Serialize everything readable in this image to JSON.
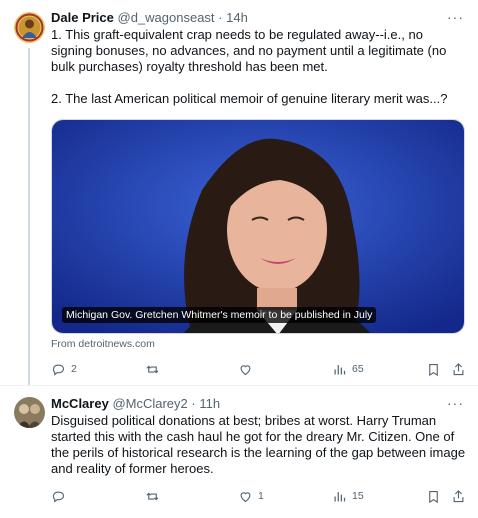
{
  "tweets": [
    {
      "name": "Dale Price",
      "handle": "@d_wagonseast",
      "time": "14h",
      "paragraphs": [
        "1. This graft-equivalent crap needs to be regulated away--i.e., no signing bonuses, no advances, and no payment until a legitimate (no bulk purchases) royalty threshold has been met.",
        "2. The last American political memoir of genuine literary merit was...?"
      ],
      "card": {
        "caption": "Michigan Gov. Gretchen Whitmer's memoir to be published in July",
        "source": "From detroitnews.com"
      },
      "stats": {
        "replies": "2",
        "retweets": "",
        "likes": "",
        "views": "65"
      }
    },
    {
      "name": "McClarey",
      "handle": "@McClarey2",
      "time": "11h",
      "paragraphs": [
        "Disguised political donations at best;  bribes at worst.  Harry Truman started this with the cash haul he got for the dreary Mr. Citizen.  One of the perils of historical research is the learning of the gap between image and reality of former heroes."
      ],
      "stats": {
        "replies": "",
        "retweets": "",
        "likes": "1",
        "views": "15"
      }
    }
  ],
  "more_icon": "···",
  "separator": "·",
  "colors": {
    "muted": "#536471",
    "text": "#0f1419",
    "card_bg": "#1e3fa8",
    "thread_line": "#cfd9de"
  }
}
